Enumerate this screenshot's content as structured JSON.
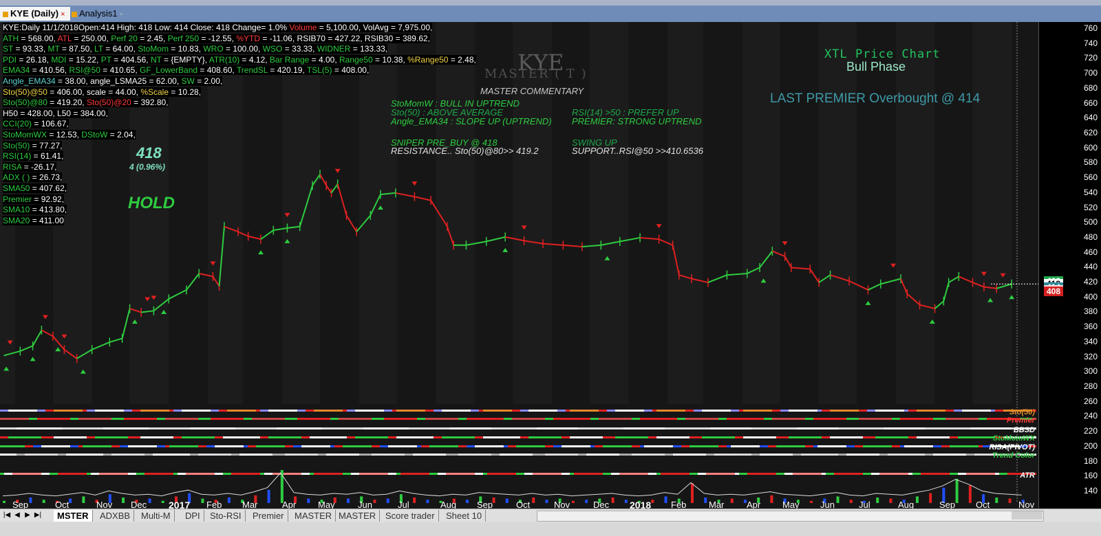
{
  "tabs": {
    "active": "KYE (Daily)",
    "second": "Analysis1",
    "close_symbol": "×",
    "second_suffix": "◦"
  },
  "info_rows": [
    [
      {
        "t": "KYE:Daily 11/1/2018Open:414 High: 418 Low: 414 Close: 418 Change= 1.0% ",
        "c": "#ffffff"
      },
      {
        "t": "Volume",
        "c": "#ff3b3b"
      },
      {
        "t": " = 5,100.00, VolAvg = 7,975.00,",
        "c": "#ffffff"
      }
    ],
    [
      {
        "t": "ATH",
        "c": "#2ecc40"
      },
      {
        "t": " = 568.00, ",
        "c": "#ffffff"
      },
      {
        "t": "ATL",
        "c": "#ff3b3b"
      },
      {
        "t": " = 250.00, ",
        "c": "#ffffff"
      },
      {
        "t": "Perf 20",
        "c": "#2ecc40"
      },
      {
        "t": " = 2.45, ",
        "c": "#ffffff"
      },
      {
        "t": "Perf 250",
        "c": "#2ecc40"
      },
      {
        "t": " = -12.55, ",
        "c": "#ffffff"
      },
      {
        "t": "%YTD",
        "c": "#ff3b3b"
      },
      {
        "t": " = -11.06, RSIB70 = 427.22, RSIB30 = 389.62,",
        "c": "#ffffff"
      }
    ],
    [
      {
        "t": "ST",
        "c": "#2ecc40"
      },
      {
        "t": " = 93.33, ",
        "c": "#ffffff"
      },
      {
        "t": "MT",
        "c": "#2ecc40"
      },
      {
        "t": " = 87.50, ",
        "c": "#ffffff"
      },
      {
        "t": "LT",
        "c": "#2ecc40"
      },
      {
        "t": " = 64.00, ",
        "c": "#ffffff"
      },
      {
        "t": "StoMom",
        "c": "#2ecc40"
      },
      {
        "t": " = 10.83, ",
        "c": "#ffffff"
      },
      {
        "t": "WRO",
        "c": "#2ecc40"
      },
      {
        "t": " = 100.00, ",
        "c": "#ffffff"
      },
      {
        "t": "WSO",
        "c": "#2ecc40"
      },
      {
        "t": " = 33.33, ",
        "c": "#ffffff"
      },
      {
        "t": "WIDNER",
        "c": "#2ecc40"
      },
      {
        "t": " = 133.33,",
        "c": "#ffffff"
      }
    ],
    [
      {
        "t": "PDI",
        "c": "#2ecc40"
      },
      {
        "t": " = 26.18, ",
        "c": "#ffffff"
      },
      {
        "t": "MDI",
        "c": "#2ecc40"
      },
      {
        "t": " = 15.22, ",
        "c": "#ffffff"
      },
      {
        "t": "PT",
        "c": "#2ecc40"
      },
      {
        "t": " = 404.56, ",
        "c": "#ffffff"
      },
      {
        "t": "NT",
        "c": "#2ecc40"
      },
      {
        "t": " = {EMPTY}, ",
        "c": "#ffffff"
      },
      {
        "t": "ATR(10)",
        "c": "#2ecc40"
      },
      {
        "t": " = 4.12, ",
        "c": "#ffffff"
      },
      {
        "t": "Bar Range",
        "c": "#2ecc40"
      },
      {
        "t": " = 4.00, ",
        "c": "#ffffff"
      },
      {
        "t": "Range50",
        "c": "#2ecc40"
      },
      {
        "t": " = 10.38, ",
        "c": "#ffffff"
      },
      {
        "t": "%Range50",
        "c": "#f5d547"
      },
      {
        "t": " = 2.48,",
        "c": "#ffffff"
      }
    ],
    [
      {
        "t": "EMA34",
        "c": "#2ecc40"
      },
      {
        "t": " = 410.56, ",
        "c": "#ffffff"
      },
      {
        "t": "RSI@50",
        "c": "#2ecc40"
      },
      {
        "t": " = 410.65, ",
        "c": "#ffffff"
      },
      {
        "t": "GF_LowerBand",
        "c": "#2ecc40"
      },
      {
        "t": " = 408.60, ",
        "c": "#ffffff"
      },
      {
        "t": "TrendSL",
        "c": "#2ecc40"
      },
      {
        "t": " = 420.19, ",
        "c": "#ffffff"
      },
      {
        "t": "TSL(5)",
        "c": "#2ecc40"
      },
      {
        "t": " = 408.00,",
        "c": "#ffffff"
      }
    ],
    [
      {
        "t": "Angle_EMA34",
        "c": "#5fd3d3"
      },
      {
        "t": " = 38.00, angle_LSMA25 = 62.00, ",
        "c": "#ffffff"
      },
      {
        "t": "SW",
        "c": "#2ecc40"
      },
      {
        "t": " = 2.00,",
        "c": "#ffffff"
      }
    ],
    [
      {
        "t": "Sto(50)@50",
        "c": "#f5d547"
      },
      {
        "t": " = 406.00, scale = 44.00, ",
        "c": "#ffffff"
      },
      {
        "t": "%Scale",
        "c": "#f5d547"
      },
      {
        "t": " = 10.28,",
        "c": "#ffffff"
      }
    ],
    [
      {
        "t": "Sto(50)@80",
        "c": "#2ecc40"
      },
      {
        "t": " = 419.20, ",
        "c": "#ffffff"
      },
      {
        "t": "Sto(50)@20",
        "c": "#ff3b3b"
      },
      {
        "t": " = 392.80,",
        "c": "#ffffff"
      }
    ],
    [
      {
        "t": "H50 = 428.00, L50 = 384.00,",
        "c": "#ffffff"
      }
    ],
    [
      {
        "t": "CCI(20)",
        "c": "#2ecc40"
      },
      {
        "t": "      = 106.67,",
        "c": "#ffffff"
      }
    ],
    [
      {
        "t": "StoMomWX",
        "c": "#2ecc40"
      },
      {
        "t": " = 12.53, ",
        "c": "#ffffff"
      },
      {
        "t": "DStoW",
        "c": "#2ecc40"
      },
      {
        "t": " = 2.04,",
        "c": "#ffffff"
      }
    ],
    [
      {
        "t": "Sto(50)",
        "c": "#2ecc40"
      },
      {
        "t": "      = 77.27,",
        "c": "#ffffff"
      }
    ],
    [
      {
        "t": "RSI(14)",
        "c": "#2ecc40"
      },
      {
        "t": "      = 61.41,",
        "c": "#ffffff"
      }
    ],
    [
      {
        "t": "RISA",
        "c": "#2ecc40"
      },
      {
        "t": "          = -26.17,",
        "c": "#ffffff"
      }
    ],
    [
      {
        "t": "ADX ( )",
        "c": "#2ecc40"
      },
      {
        "t": "       = 26.73,",
        "c": "#ffffff"
      }
    ],
    [
      {
        "t": "SMA50",
        "c": "#2ecc40"
      },
      {
        "t": "       = 407.62,",
        "c": "#ffffff"
      }
    ],
    [
      {
        "t": "Premier",
        "c": "#2ecc40"
      },
      {
        "t": "     = 92.92,",
        "c": "#ffffff"
      }
    ],
    [
      {
        "t": "SMA10",
        "c": "#2ecc40"
      },
      {
        "t": "       = 413.80,",
        "c": "#ffffff"
      }
    ],
    [
      {
        "t": "SMA20",
        "c": "#2ecc40"
      },
      {
        "t": "       = 411.00",
        "c": "#ffffff"
      }
    ]
  ],
  "overlay": {
    "price_big": "418",
    "change": "4  (0.96%)",
    "hold": "HOLD",
    "watermark_symbol": "KYE",
    "watermark_sub": "MASTER  ( T )",
    "master_commentary": "MASTER  COMMENTARY",
    "xtl": "XTL Price Chart",
    "phase": "Bull Phase",
    "last_premier": "LAST PREMIER Overbought @ 414"
  },
  "commentary": [
    {
      "text": "StoMomW :  BULL  IN UPTREND",
      "color": "#2ecc40"
    },
    {
      "text": "Sto(50)  :  ABOVE AVERAGE",
      "color": "#1fa84a"
    },
    {
      "text": "Angle_EMA34  :  SLOPE UP  (UPTREND)",
      "color": "#2ecc40"
    },
    {
      "text": "RSI(14) >50  : PREFER  UP",
      "color": "#1fa84a"
    },
    {
      "text": "PREMIER:  STRONG UPTREND",
      "color": "#2ecc40"
    },
    {
      "text": "SNIPER   PRE_BUY  @  418",
      "color": "#2ecc40"
    },
    {
      "text": "RESISTANCE.. Sto(50)@80>> 419.2",
      "color": "#e0e0e0"
    },
    {
      "text": "SWING  UP",
      "color": "#1fa84a"
    },
    {
      "text": "SUPPORT..RSI@50 >>410.6536",
      "color": "#e0e0e0"
    }
  ],
  "indicator_labels": [
    {
      "text": "Sto(50)",
      "color": "#e08a2a"
    },
    {
      "text": "Premier",
      "color": "#ff3b3b"
    },
    {
      "text": "BBSD",
      "color": "#ffffff"
    },
    {
      "text": "StoMomWX",
      "color": "#2ecc40"
    },
    {
      "text": "RISA(PIVOT)",
      "color": "#ffffff"
    },
    {
      "text": "Trend Color",
      "color": "#2ecc40"
    },
    {
      "text": "ATR",
      "color": "#ffffff"
    }
  ],
  "price_boxes": [
    {
      "text": "422",
      "bg": "#1fa84a",
      "fg": "#ffffff"
    },
    {
      "text": "418",
      "bg": "#ffffff",
      "fg": "#000000"
    },
    {
      "text": "414",
      "bg": "#2b8a9a",
      "fg": "#ffffff"
    },
    {
      "text": "410",
      "bg": "#ffd6d6",
      "fg": "#000000"
    },
    {
      "text": "408",
      "bg": "#d42020",
      "fg": "#ffffff"
    }
  ],
  "sheet_tabs": [
    "MSTER",
    "ADXBB",
    "Multi-M",
    "DPI",
    "Sto-RSI",
    "Premier",
    "MASTER",
    "MASTER",
    "Score trader",
    "Sheet 10"
  ],
  "nav_buttons": [
    "|◀",
    "◀",
    "▶",
    "▶|"
  ],
  "colors": {
    "up": "#2ecc40",
    "down": "#e02020",
    "neutral": "#ffffff",
    "background": "#161616"
  },
  "chart_data": {
    "type": "line",
    "title": "KYE (Daily)",
    "ylim": [
      140,
      770
    ],
    "y_ticks": [
      760,
      740,
      720,
      700,
      680,
      660,
      640,
      620,
      600,
      580,
      560,
      540,
      520,
      500,
      480,
      460,
      440,
      420,
      400,
      380,
      360,
      340,
      320,
      300,
      280,
      260,
      240,
      220,
      200,
      180,
      160,
      140
    ],
    "x_ticks": [
      "Sep",
      "Oct",
      "Nov",
      "Dec",
      "2017",
      "Feb",
      "Mar",
      "Apr",
      "May",
      "Jun",
      "Jul",
      "Aug",
      "Sep",
      "Oct",
      "Nov",
      "Dec",
      "2018",
      "Feb",
      "Mar",
      "Apr",
      "May",
      "Jun",
      "Jul",
      "Aug",
      "Sep",
      "Oct",
      "Nov"
    ],
    "series": [
      {
        "name": "Close",
        "points": [
          [
            "2016-08-23",
            322
          ],
          [
            "2016-09-05",
            328
          ],
          [
            "2016-09-15",
            335
          ],
          [
            "2016-09-22",
            356
          ],
          [
            "2016-10-01",
            348
          ],
          [
            "2016-10-10",
            330
          ],
          [
            "2016-10-20",
            318
          ],
          [
            "2016-11-01",
            330
          ],
          [
            "2016-11-15",
            340
          ],
          [
            "2016-11-25",
            345
          ],
          [
            "2016-12-01",
            385
          ],
          [
            "2016-12-10",
            380
          ],
          [
            "2016-12-20",
            382
          ],
          [
            "2017-01-01",
            398
          ],
          [
            "2017-01-15",
            410
          ],
          [
            "2017-01-25",
            432
          ],
          [
            "2017-02-05",
            428
          ],
          [
            "2017-02-10",
            415
          ],
          [
            "2017-02-14",
            495
          ],
          [
            "2017-02-25",
            488
          ],
          [
            "2017-03-05",
            482
          ],
          [
            "2017-03-15",
            478
          ],
          [
            "2017-03-25",
            490
          ],
          [
            "2017-04-05",
            493
          ],
          [
            "2017-04-15",
            495
          ],
          [
            "2017-04-25",
            550
          ],
          [
            "2017-05-01",
            565
          ],
          [
            "2017-05-06",
            550
          ],
          [
            "2017-05-10",
            540
          ],
          [
            "2017-05-15",
            552
          ],
          [
            "2017-05-22",
            510
          ],
          [
            "2017-05-30",
            488
          ],
          [
            "2017-06-10",
            510
          ],
          [
            "2017-06-18",
            538
          ],
          [
            "2017-06-30",
            540
          ],
          [
            "2017-07-15",
            535
          ],
          [
            "2017-07-28",
            530
          ],
          [
            "2017-08-10",
            495
          ],
          [
            "2017-08-15",
            470
          ],
          [
            "2017-08-25",
            470
          ],
          [
            "2017-09-10",
            475
          ],
          [
            "2017-09-25",
            481
          ],
          [
            "2017-10-10",
            476
          ],
          [
            "2017-10-25",
            472
          ],
          [
            "2017-11-10",
            470
          ],
          [
            "2017-11-25",
            468
          ],
          [
            "2017-12-10",
            470
          ],
          [
            "2017-12-25",
            475
          ],
          [
            "2018-01-10",
            480
          ],
          [
            "2018-01-25",
            478
          ],
          [
            "2018-02-05",
            470
          ],
          [
            "2018-02-10",
            430
          ],
          [
            "2018-02-20",
            425
          ],
          [
            "2018-03-05",
            420
          ],
          [
            "2018-03-20",
            430
          ],
          [
            "2018-04-05",
            432
          ],
          [
            "2018-04-15",
            440
          ],
          [
            "2018-04-25",
            462
          ],
          [
            "2018-05-05",
            455
          ],
          [
            "2018-05-10",
            440
          ],
          [
            "2018-05-25",
            438
          ],
          [
            "2018-06-01",
            420
          ],
          [
            "2018-06-10",
            430
          ],
          [
            "2018-06-25",
            422
          ],
          [
            "2018-07-10",
            410
          ],
          [
            "2018-07-20",
            418
          ],
          [
            "2018-08-05",
            425
          ],
          [
            "2018-08-10",
            405
          ],
          [
            "2018-08-20",
            390
          ],
          [
            "2018-09-01",
            385
          ],
          [
            "2018-09-08",
            395
          ],
          [
            "2018-09-12",
            420
          ],
          [
            "2018-09-20",
            428
          ],
          [
            "2018-10-01",
            420
          ],
          [
            "2018-10-10",
            414
          ],
          [
            "2018-10-20",
            412
          ],
          [
            "2018-11-01",
            418
          ]
        ]
      }
    ],
    "markers_up": [
      "2016-08-25",
      "2016-09-15",
      "2016-10-05",
      "2016-10-25",
      "2016-12-05",
      "2016-12-28",
      "2017-03-15",
      "2017-04-05",
      "2017-06-18",
      "2017-09-25",
      "2017-12-15",
      "2018-04-18",
      "2018-07-10",
      "2018-08-30",
      "2018-10-15",
      "2018-11-01"
    ],
    "markers_down": [
      "2016-08-28",
      "2016-09-25",
      "2016-10-10",
      "2016-12-15",
      "2016-12-20",
      "2017-02-05",
      "2017-04-05",
      "2017-05-15",
      "2017-07-15",
      "2017-10-10",
      "2018-01-25",
      "2018-05-05",
      "2018-07-30",
      "2018-10-10",
      "2018-10-25"
    ],
    "volume": [
      2,
      3,
      5,
      3,
      2,
      4,
      6,
      3,
      8,
      5,
      3,
      4,
      2,
      6,
      9,
      4,
      3,
      5,
      3,
      7,
      12,
      30,
      6,
      4,
      3,
      5,
      4,
      6,
      3,
      4,
      8,
      5,
      3,
      2,
      4,
      3,
      6,
      5,
      4,
      3,
      5,
      3,
      4,
      2,
      3,
      4,
      5,
      3,
      2,
      3,
      6,
      4,
      18,
      5,
      3,
      4,
      3,
      5,
      7,
      4,
      3,
      2,
      4,
      6,
      3,
      2,
      5,
      4,
      3,
      6,
      9,
      14,
      22,
      16,
      8,
      5,
      4,
      3
    ],
    "indicator_strips": [
      "Sto(50)",
      "Premier",
      "BBSD",
      "StoMomWX",
      "RISA(PIVOT)",
      "Trend Color",
      "ATR"
    ]
  }
}
